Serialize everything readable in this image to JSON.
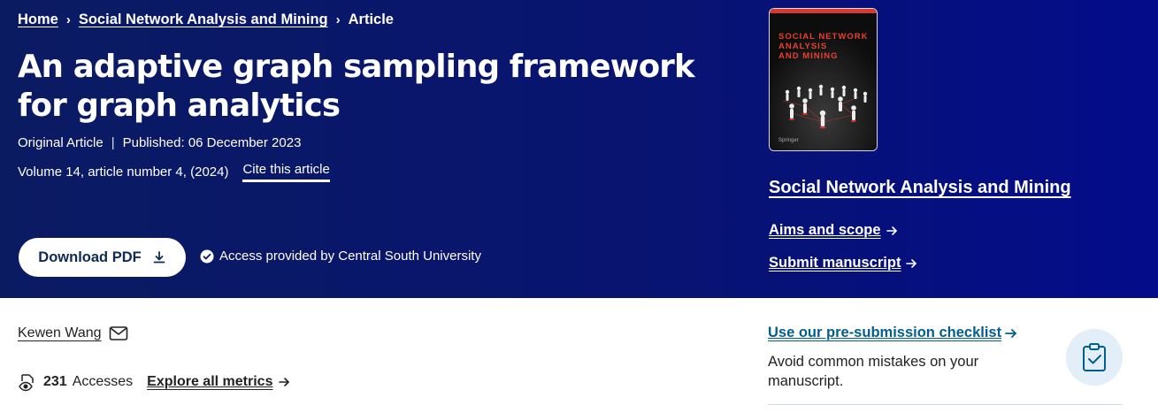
{
  "breadcrumb": {
    "home": "Home",
    "journal": "Social Network Analysis and Mining",
    "current": "Article"
  },
  "article": {
    "title": "An adaptive graph sampling framework for graph analytics",
    "type": "Original Article",
    "published": "Published: 06 December 2023",
    "volume": "Volume 14, article number 4, (2024)",
    "cite_label": "Cite this article"
  },
  "actions": {
    "download_label": "Download PDF",
    "access_text": "Access provided by Central South University"
  },
  "journal": {
    "cover_title_line1": "SOCIAL NETWORK",
    "cover_title_line2": "ANALYSIS",
    "cover_title_line3": "AND MINING",
    "cover_publisher": "Springer",
    "name": "Social Network Analysis and Mining",
    "aims_label": "Aims and scope",
    "submit_label": "Submit manuscript"
  },
  "author": {
    "name": "Kewen Wang"
  },
  "metrics": {
    "accesses_count": "231",
    "accesses_label": "Accesses",
    "explore_label": "Explore all metrics"
  },
  "checklist": {
    "link_label": "Use our pre-submission checklist",
    "description": "Avoid common mistakes on your manuscript."
  },
  "colors": {
    "hero_bg": "#081470",
    "link_blue": "#025e8d",
    "cover_accent": "#e8412f"
  }
}
